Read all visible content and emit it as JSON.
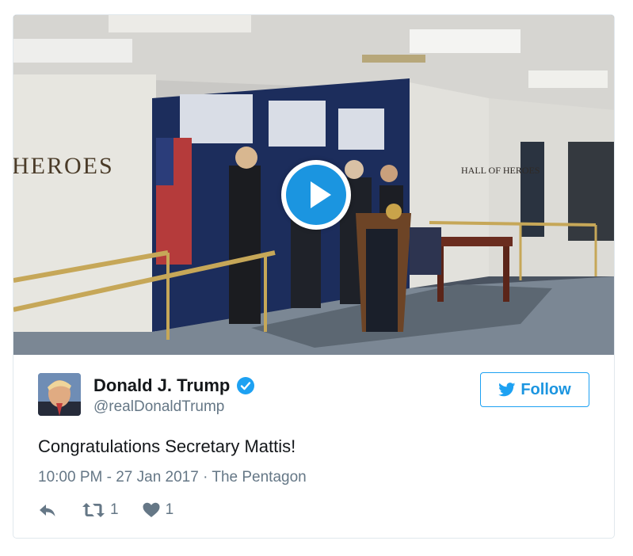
{
  "media": {
    "wall_sign_left": "HEROES",
    "wall_sign_right": "HALL OF HEROES",
    "play_icon": "play-icon"
  },
  "author": {
    "display_name": "Donald J. Trump",
    "handle": "@realDonaldTrump",
    "verified": true,
    "verified_icon": "verified-badge-icon"
  },
  "follow": {
    "label": "Follow",
    "icon": "twitter-bird-icon"
  },
  "tweet": {
    "text": "Congratulations Secretary Mattis!",
    "timestamp": "10:00 PM - 27 Jan 2017 · The Pentagon"
  },
  "actions": {
    "reply_icon": "reply-icon",
    "retweet_icon": "retweet-icon",
    "retweet_count": "1",
    "like_icon": "heart-icon",
    "like_count": "1"
  },
  "colors": {
    "accent": "#1da1f2",
    "text": "#14171a",
    "secondary": "#657786",
    "border": "#e1e8ed"
  }
}
